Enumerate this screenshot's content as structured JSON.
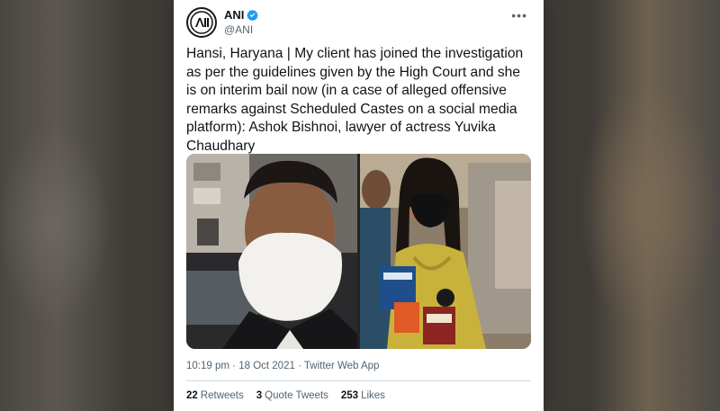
{
  "account": {
    "display_name": "ANI",
    "handle": "@ANI",
    "avatar_icon": "ani-logo-icon",
    "verified_icon": "verified-badge-icon",
    "verified_color": "#1d9bf0"
  },
  "menu_icon": "more-options-icon",
  "tweet": {
    "text": "Hansi, Haryana | My client has joined the investigation as per the guidelines given by the High Court and she is on interim bail now (in a case of alleged offensive remarks against Scheduled Castes on a social media platform): Ashok Bishnoi, lawyer of actress Yuvika Chaudhary"
  },
  "meta": {
    "time": "10:19 pm",
    "separator": "·",
    "date": "18 Oct 2021",
    "source": "Twitter Web App"
  },
  "stats": {
    "retweets_count": "22",
    "retweets_label": "Retweets",
    "quote_count": "3",
    "quote_label": "Quote Tweets",
    "likes_count": "253",
    "likes_label": "Likes"
  }
}
